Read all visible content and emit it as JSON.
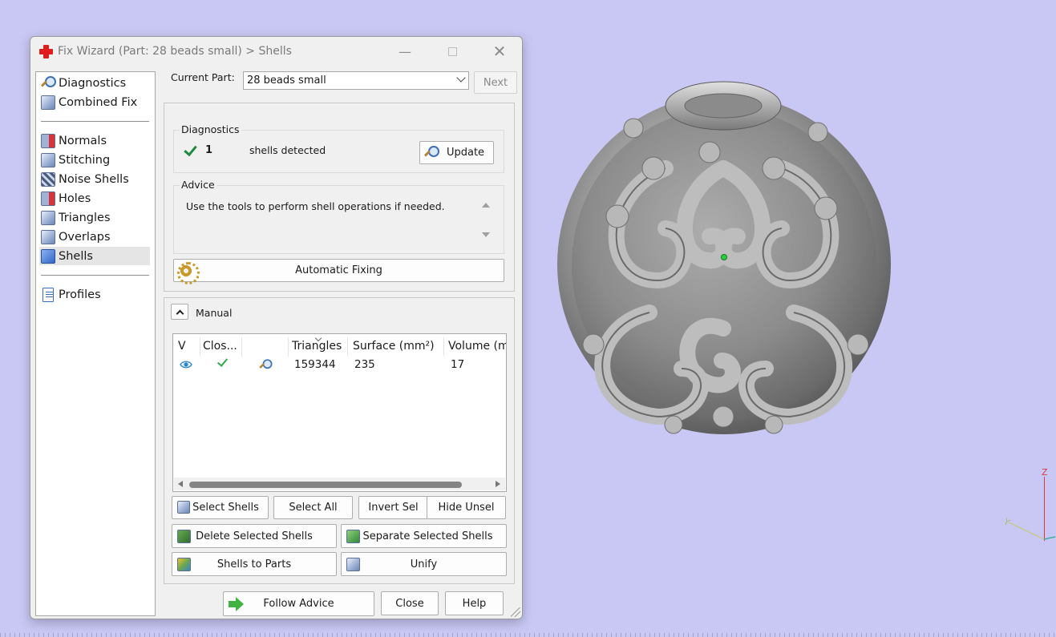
{
  "window": {
    "title": "Fix Wizard (Part: 28 beads small) > Shells"
  },
  "nav": {
    "items": [
      {
        "label": "Diagnostics",
        "icon": "magnifier-icon"
      },
      {
        "label": "Combined Fix",
        "icon": "combined-fix-icon"
      },
      {
        "label": "Normals",
        "icon": "normals-icon"
      },
      {
        "label": "Stitching",
        "icon": "stitching-icon"
      },
      {
        "label": "Noise Shells",
        "icon": "noise-shells-icon"
      },
      {
        "label": "Holes",
        "icon": "holes-icon"
      },
      {
        "label": "Triangles",
        "icon": "triangles-icon"
      },
      {
        "label": "Overlaps",
        "icon": "overlaps-icon"
      },
      {
        "label": "Shells",
        "icon": "shells-icon",
        "selected": true
      },
      {
        "label": "Profiles",
        "icon": "profiles-icon"
      }
    ]
  },
  "top": {
    "current_part_label": "Current Part:",
    "current_part_value": "28 beads small",
    "next_label": "Next"
  },
  "diagnostics": {
    "title": "Diagnostics",
    "count": "1",
    "text": "shells detected",
    "update_label": "Update"
  },
  "advice": {
    "title": "Advice",
    "text": "Use the tools to perform shell operations if needed."
  },
  "automatic_fixing_label": "Automatic Fixing",
  "manual": {
    "title": "Manual",
    "columns": [
      "V",
      "Clos...",
      "",
      "Triangles",
      "Surface (mm²)",
      "Volume (m"
    ],
    "row": {
      "triangles": "159344",
      "surface": "235",
      "volume": "17"
    }
  },
  "buttons": {
    "select_shells": "Select Shells",
    "select_all": "Select All",
    "invert_sel": "Invert Sel",
    "hide_unsel": "Hide Unsel",
    "delete_selected": "Delete Selected Shells",
    "separate_selected": "Separate Selected Shells",
    "shells_to_parts": "Shells to Parts",
    "unify": "Unify",
    "follow_advice": "Follow Advice",
    "close": "Close",
    "help": "Help"
  },
  "axes": {
    "z": "Z",
    "y": "Y"
  },
  "colors": {
    "viewport": "#c9c8f5",
    "accent_red": "#e01d1d",
    "check_green": "#1f8a3c"
  }
}
